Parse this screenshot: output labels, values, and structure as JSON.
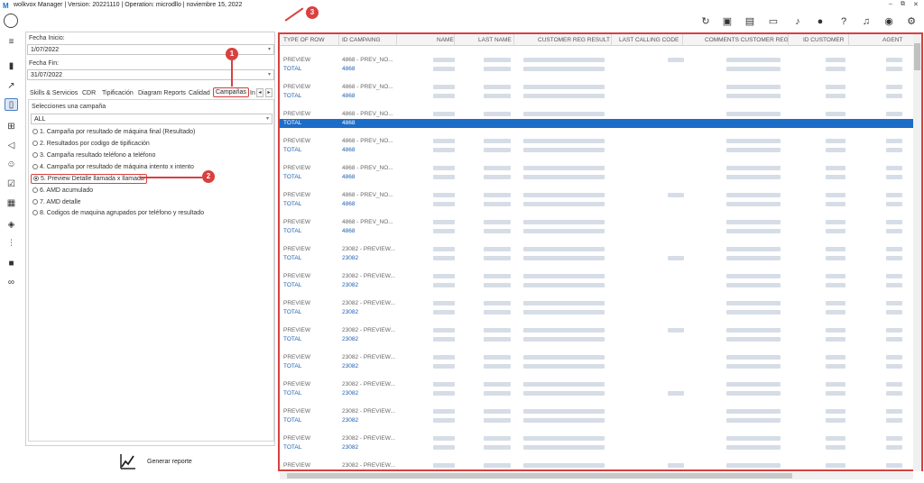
{
  "window": {
    "title": "wolkvox Manager  | Version: 20221110  |  Operation: microdllo  | noviembre 15, 2022",
    "controls": [
      "–",
      "⧉",
      "✕"
    ]
  },
  "toolbar_icons": [
    "refresh-icon",
    "gift-icon",
    "reports-icon",
    "contact-card-icon",
    "music-icon",
    "microphone-icon",
    "help-icon",
    "bell-icon",
    "user-icon",
    "settings-icon"
  ],
  "sidebar_icons": [
    "menu-icon",
    "bar-chart-icon",
    "trend-icon",
    "document-icon",
    "hierarchy-icon",
    "megaphone-icon",
    "group-icon",
    "checklist-icon",
    "calculator-icon",
    "shield-icon",
    "audio-wave-icon",
    "video-icon",
    "voicemail-icon"
  ],
  "filters": {
    "start_label": "Fecha Inicio:",
    "start_value": "1/07/2022",
    "end_label": "Fecha Fin:",
    "end_value": "31/07/2022"
  },
  "tabs": [
    "Skills & Servicios",
    "CDR",
    "Tipificación",
    "Diagram Reports",
    "Calidad",
    "Campañas",
    "In"
  ],
  "active_tab": "Campañas",
  "campaign": {
    "select_label": "Selecciones una campaña",
    "select_value": "ALL",
    "options": [
      "1. Campaña por resultado de máquina final (Resultado)",
      "2. Resultados por codigo de tipificación",
      "3. Campaña resultado teléfono a teléfono",
      "4. Campaña por resultado de máquina intento x intento",
      "5. Preview Detalle llamada x llamada",
      "6. AMD acumulado",
      "7. AMD detalle",
      "8. Codigos de maquina agrupados por teléfono y resultado"
    ],
    "selected_index": 4
  },
  "generate_button": "Generar reporte",
  "grid": {
    "columns": [
      "TYPE OF ROW",
      "ID CAMPAING",
      "NAME",
      "LAST NAME",
      "CUSTOMER REG RESULT",
      "LAST CALLING CODE",
      "COMMENTS CUSTOMER REG",
      "ID CUSTOMER",
      "AGENT"
    ],
    "rows": [
      {
        "type": "PREVIEW",
        "id": "4868 - PREV_NO..."
      },
      {
        "type": "TOTAL",
        "id": "4868"
      },
      {
        "type": "PREVIEW",
        "id": "4868 - PREV_NO..."
      },
      {
        "type": "TOTAL",
        "id": "4868"
      },
      {
        "type": "PREVIEW",
        "id": "4868 - PREV_NO..."
      },
      {
        "type": "TOTAL",
        "id": "4868",
        "selected": true
      },
      {
        "type": "PREVIEW",
        "id": "4868 - PREV_NO..."
      },
      {
        "type": "TOTAL",
        "id": "4868"
      },
      {
        "type": "PREVIEW",
        "id": "4868 - PREV_NO..."
      },
      {
        "type": "TOTAL",
        "id": "4868"
      },
      {
        "type": "PREVIEW",
        "id": "4868 - PREV_NO..."
      },
      {
        "type": "TOTAL",
        "id": "4868"
      },
      {
        "type": "PREVIEW",
        "id": "4868 - PREV_NO..."
      },
      {
        "type": "TOTAL",
        "id": "4868"
      },
      {
        "type": "PREVIEW",
        "id": "23082 - PREVIEW..."
      },
      {
        "type": "TOTAL",
        "id": "23082"
      },
      {
        "type": "PREVIEW",
        "id": "23082 - PREVIEW..."
      },
      {
        "type": "TOTAL",
        "id": "23082"
      },
      {
        "type": "PREVIEW",
        "id": "23082 - PREVIEW..."
      },
      {
        "type": "TOTAL",
        "id": "23082"
      },
      {
        "type": "PREVIEW",
        "id": "23082 - PREVIEW..."
      },
      {
        "type": "TOTAL",
        "id": "23082"
      },
      {
        "type": "PREVIEW",
        "id": "23082 - PREVIEW..."
      },
      {
        "type": "TOTAL",
        "id": "23082"
      },
      {
        "type": "PREVIEW",
        "id": "23082 - PREVIEW..."
      },
      {
        "type": "TOTAL",
        "id": "23082"
      },
      {
        "type": "PREVIEW",
        "id": "23082 - PREVIEW..."
      },
      {
        "type": "TOTAL",
        "id": "23082"
      },
      {
        "type": "PREVIEW",
        "id": "23082 - PREVIEW..."
      },
      {
        "type": "TOTAL",
        "id": "23082"
      },
      {
        "type": "PREVIEW",
        "id": "23082 - PREVIEW..."
      }
    ]
  },
  "annotations": [
    "1",
    "2",
    "3"
  ],
  "colors": {
    "accent": "#1c6dc7",
    "highlight": "#d94040"
  }
}
